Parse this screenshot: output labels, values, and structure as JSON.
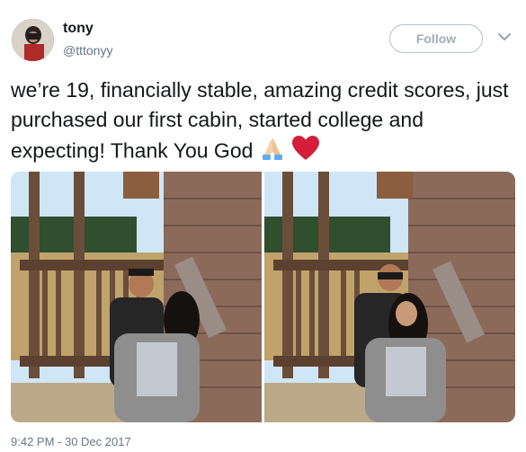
{
  "author": {
    "name": "tony",
    "handle": "@tttonyy"
  },
  "follow_label": "Follow",
  "tweet": {
    "text": "we’re 19, financially stable, amazing credit scores, just purchased our first cabin, started college and expecting! Thank You God",
    "emojis": [
      "folded-hands-icon",
      "red-heart-icon"
    ],
    "timestamp": "9:42 PM - 30 Dec 2017"
  },
  "colors": {
    "text": "#14171a",
    "muted": "#657786",
    "heart": "#e0245e"
  }
}
